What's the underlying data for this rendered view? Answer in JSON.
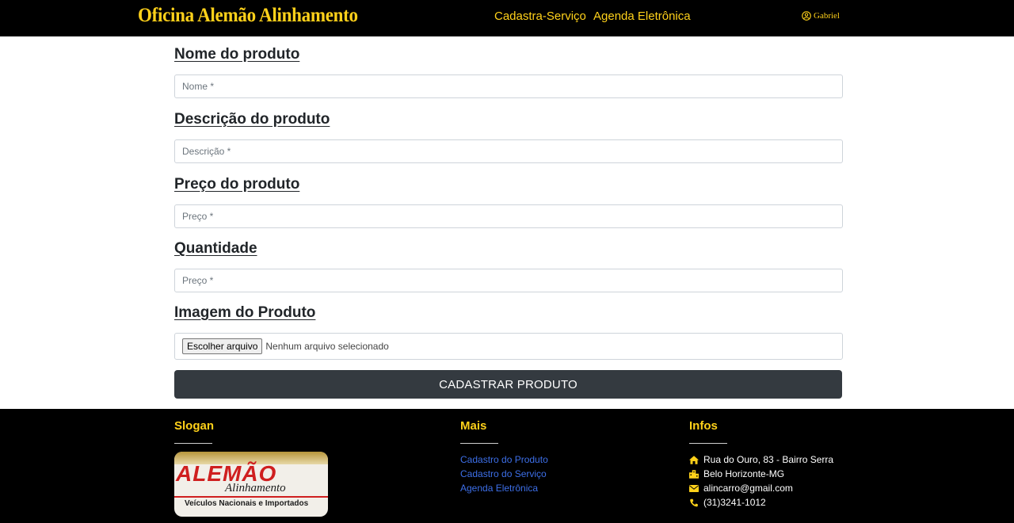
{
  "header": {
    "brand": "Oficina Alemão Alinhamento",
    "nav": [
      "Cadastra-Serviço",
      "Agenda Eletrônica"
    ],
    "user": "Gabriel"
  },
  "form": {
    "name_label": "Nome do produto",
    "name_placeholder": "Nome *",
    "desc_label": "Descrição do produto",
    "desc_placeholder": "Descrição *",
    "price_label": "Preço do produto",
    "price_placeholder": "Preço *",
    "qty_label": "Quantidade",
    "qty_placeholder": "Preço *",
    "image_label": "Imagem do Produto",
    "file_button": "Escolher arquivo",
    "file_status": "Nenhum arquivo selecionado",
    "submit": "CADASTRAR PRODUTO"
  },
  "footer": {
    "slogan_title": "Slogan",
    "logo": {
      "brand": "ALEMÃO",
      "script": "Alinhamento",
      "sub": "Veículos Nacionais e Importados"
    },
    "more_title": "Mais",
    "links": [
      "Cadastro do Produto",
      "Cadastro do Serviço",
      "Agenda Eletrônica"
    ],
    "infos_title": "Infos",
    "infos": [
      {
        "icon": "home-icon",
        "text": "Rua do Ouro, 83 - Bairro Serra"
      },
      {
        "icon": "city-icon",
        "text": "Belo Horizonte-MG"
      },
      {
        "icon": "envelope-icon",
        "text": "alincarro@gmail.com"
      },
      {
        "icon": "phone-icon",
        "text": "(31)3241-1012"
      }
    ]
  },
  "colors": {
    "accent": "#ffd11a",
    "bar": "#000000",
    "button": "#343a40",
    "link": "#3d6fe8"
  }
}
